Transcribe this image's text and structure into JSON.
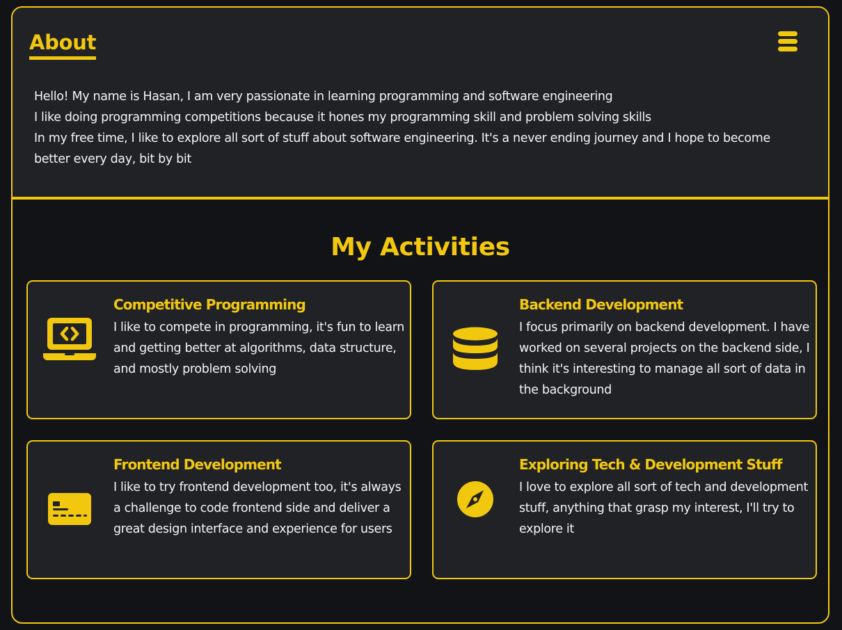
{
  "about": {
    "title": "About",
    "paragraphs": [
      "Hello! My name is Hasan, I am very passionate in learning programming and software engineering",
      "I like doing programming competitions because it hones my programming skill and problem solving skills",
      "In my free time, I like to explore all sort of stuff about software engineering. It's a never ending journey and I hope to become better every day, bit by bit"
    ],
    "menu_icon": "menu-icon"
  },
  "activities": {
    "title": "My Activities",
    "cards": [
      {
        "title": "Competitive Programming",
        "text": "I like to compete in programming, it's fun to learn and getting better at algorithms, data structure, and mostly problem solving",
        "icon": "laptop-code-icon"
      },
      {
        "title": "Backend Development",
        "text": "I focus primarily on backend development. I have worked on several projects on the backend side, I think it's interesting to manage all sort of data in the background",
        "icon": "database-icon"
      },
      {
        "title": "Frontend Development",
        "text": "I like to try frontend development too, it's always a challenge to code frontend side and deliver a great design interface and experience for users",
        "icon": "interface-card-icon"
      },
      {
        "title": "Exploring Tech & Development Stuff",
        "text": "I love to explore all sort of tech and development stuff, anything that grasp my interest, I'll try to explore it",
        "icon": "compass-icon"
      }
    ]
  },
  "colors": {
    "accent": "#f2c80f",
    "panel": "#212226",
    "background": "#121317",
    "text": "#f4f4f4"
  }
}
